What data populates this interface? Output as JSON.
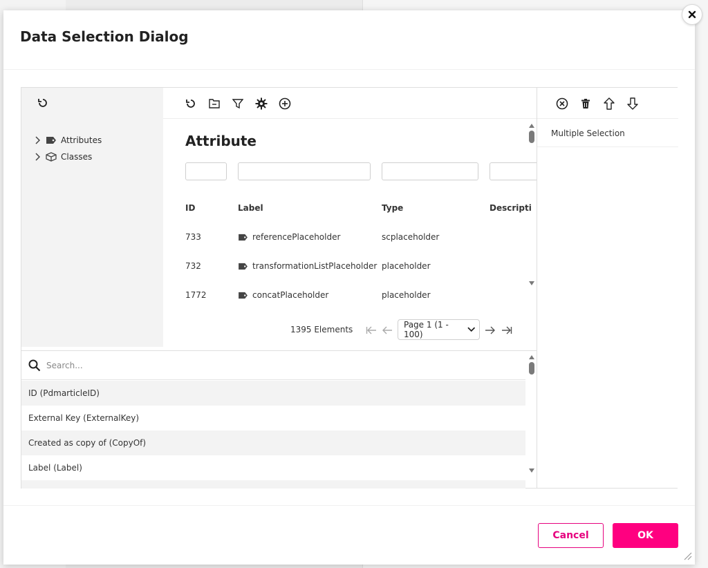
{
  "dialog": {
    "title": "Data Selection Dialog"
  },
  "tree": {
    "items": [
      {
        "label": "Attributes",
        "icon": "tag-icon"
      },
      {
        "label": "Classes",
        "icon": "cube-icon"
      }
    ]
  },
  "grid": {
    "title": "Attribute",
    "columns": [
      "ID",
      "Label",
      "Type",
      "Descripti"
    ],
    "rows": [
      {
        "id": "733",
        "label": "referencePlaceholder",
        "type": "scplaceholder"
      },
      {
        "id": "732",
        "label": "transformationListPlaceholder",
        "type": "placeholder"
      },
      {
        "id": "1772",
        "label": "concatPlaceholder",
        "type": "placeholder"
      }
    ]
  },
  "pager": {
    "count": "1395 Elements",
    "page": "Page 1 (1 - 100)"
  },
  "selection": {
    "label": "Multiple Selection"
  },
  "search": {
    "placeholder": "Search...",
    "items": [
      "ID (PdmarticleID)",
      "External Key (ExternalKey)",
      "Created as copy of (CopyOf)",
      "Label (Label)"
    ]
  },
  "buttons": {
    "cancel": "Cancel",
    "ok": "OK"
  },
  "colors": {
    "accent": "#ff0080",
    "accent_border": "#e6007e",
    "panel_gray": "#f3f3f3"
  }
}
